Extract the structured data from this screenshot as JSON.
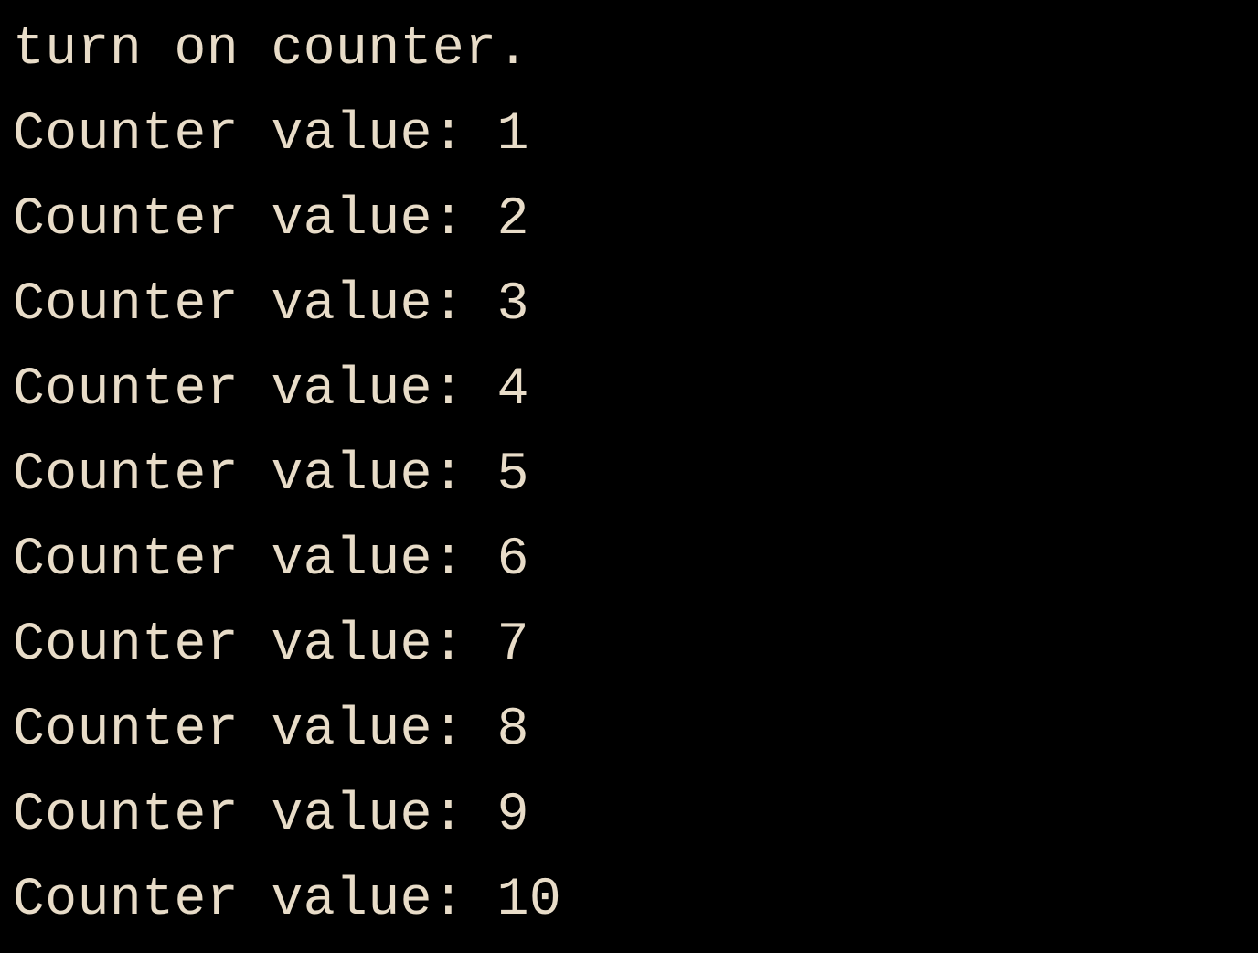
{
  "terminal": {
    "lines": [
      "turn on counter.",
      "Counter value: 1",
      "Counter value: 2",
      "Counter value: 3",
      "Counter value: 4",
      "Counter value: 5",
      "Counter value: 6",
      "Counter value: 7",
      "Counter value: 8",
      "Counter value: 9",
      "Counter value: 10"
    ]
  }
}
